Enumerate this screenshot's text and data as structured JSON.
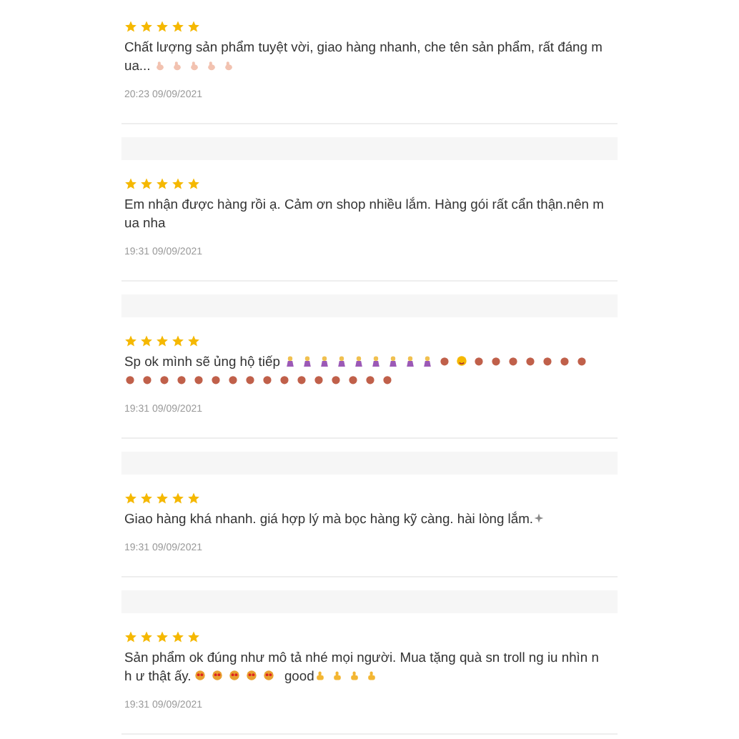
{
  "reviews": [
    {
      "stars": 5,
      "comment": [
        {
          "kind": "text",
          "text": "Chất lượng sản phẩm tuyệt vời, giao hàng nhanh, che tên sản phẩm, rất đáng m ua... "
        },
        {
          "kind": "hand"
        },
        {
          "kind": "hand"
        },
        {
          "kind": "hand"
        },
        {
          "kind": "hand"
        },
        {
          "kind": "hand"
        }
      ],
      "date": "20:23 09/09/2021"
    },
    {
      "stars": 5,
      "comment": [
        {
          "kind": "text",
          "text": "Em nhận được hàng rồi ạ. Cảm ơn shop nhiều lắm. Hàng gói rất cẩn thận.nên m ua nha"
        }
      ],
      "date": "19:31 09/09/2021"
    },
    {
      "stars": 5,
      "comment": [
        {
          "kind": "text",
          "text": "Sp ok mình sẽ ủng hộ tiếp "
        },
        {
          "kind": "person"
        },
        {
          "kind": "person"
        },
        {
          "kind": "person"
        },
        {
          "kind": "person"
        },
        {
          "kind": "person"
        },
        {
          "kind": "person"
        },
        {
          "kind": "person"
        },
        {
          "kind": "person"
        },
        {
          "kind": "person"
        },
        {
          "kind": "dot"
        },
        {
          "kind": "face"
        },
        {
          "kind": "dot"
        },
        {
          "kind": "dot"
        },
        {
          "kind": "dot"
        },
        {
          "kind": "dot"
        },
        {
          "kind": "dot"
        },
        {
          "kind": "dot"
        },
        {
          "kind": "dot"
        },
        {
          "kind": "dot"
        },
        {
          "kind": "dot"
        },
        {
          "kind": "dot"
        },
        {
          "kind": "dot"
        },
        {
          "kind": "dot"
        },
        {
          "kind": "dot"
        },
        {
          "kind": "dot"
        },
        {
          "kind": "dot"
        },
        {
          "kind": "dot"
        },
        {
          "kind": "dot"
        },
        {
          "kind": "dot"
        },
        {
          "kind": "dot"
        },
        {
          "kind": "dot"
        },
        {
          "kind": "dot"
        },
        {
          "kind": "dot"
        },
        {
          "kind": "dot"
        }
      ],
      "date": "19:31 09/09/2021"
    },
    {
      "stars": 5,
      "comment": [
        {
          "kind": "text",
          "text": "Giao hàng khá nhanh. giá hợp lý mà bọc hàng kỹ càng. hài lòng lắm."
        },
        {
          "kind": "sparkle"
        }
      ],
      "date": "19:31 09/09/2021"
    },
    {
      "stars": 5,
      "comment": [
        {
          "kind": "text",
          "text": "Sản phẩm ok đúng như mô tả nhé mọi người. Mua tặng quà sn troll ng iu nhìn nh ư thật ấy. "
        },
        {
          "kind": "blush"
        },
        {
          "kind": "blush"
        },
        {
          "kind": "blush"
        },
        {
          "kind": "blush"
        },
        {
          "kind": "blush"
        },
        {
          "kind": "text",
          "text": " good"
        },
        {
          "kind": "thumb"
        },
        {
          "kind": "thumb"
        },
        {
          "kind": "thumb"
        },
        {
          "kind": "thumb"
        }
      ],
      "date": "19:31 09/09/2021"
    }
  ]
}
